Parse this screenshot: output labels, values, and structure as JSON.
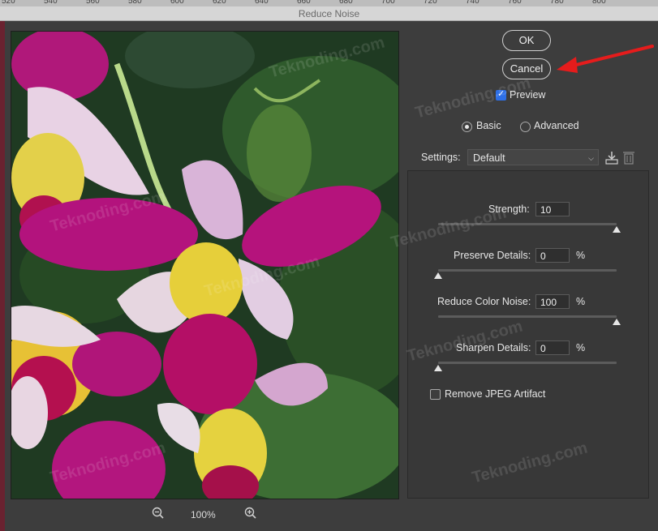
{
  "window": {
    "title": "Reduce Noise"
  },
  "ruler": {
    "ticks": [
      "520",
      "540",
      "560",
      "580",
      "600",
      "620",
      "640",
      "660",
      "680",
      "700",
      "720",
      "740",
      "760",
      "780",
      "800"
    ]
  },
  "preview": {
    "zoom": "100%"
  },
  "buttons": {
    "ok": "OK",
    "cancel": "Cancel"
  },
  "options": {
    "preview_label": "Preview",
    "preview_checked": true,
    "mode_basic": "Basic",
    "mode_advanced": "Advanced",
    "selected_mode": "Basic"
  },
  "settings": {
    "label": "Settings:",
    "value": "Default"
  },
  "sliders": [
    {
      "label": "Strength:",
      "value": "10",
      "unit": "",
      "level": 1.0
    },
    {
      "label": "Preserve Details:",
      "value": "0",
      "unit": "%",
      "level": 0.0
    },
    {
      "label": "Reduce Color Noise:",
      "value": "100",
      "unit": "%",
      "level": 1.0
    },
    {
      "label": "Sharpen Details:",
      "value": "0",
      "unit": "%",
      "level": 0.0
    }
  ],
  "jpeg_artifact": {
    "label": "Remove JPEG Artifact",
    "checked": false
  },
  "watermark": "Teknoding.com",
  "colors": {
    "accent": "#2d6fe6",
    "arrow": "#e51c1c"
  }
}
